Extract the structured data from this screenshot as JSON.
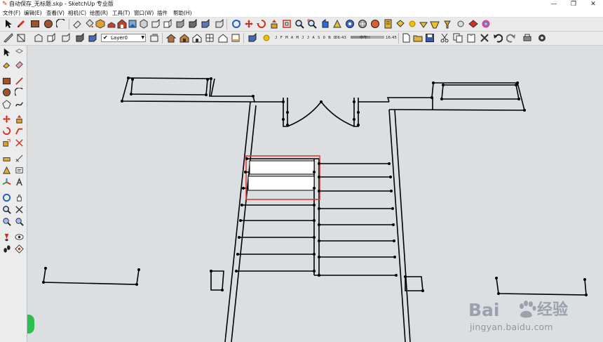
{
  "window": {
    "title": "自动保存_无标题.skp - SketchUp 专业版",
    "minimize_glyph": "—",
    "restore_glyph": "❐",
    "close_glyph": "✕"
  },
  "menu": [
    "文件(F)",
    "编辑(E)",
    "查看(V)",
    "相机(C)",
    "绘图(R)",
    "工具(T)",
    "窗口(W)",
    "插件",
    "帮助(H)"
  ],
  "layer_selector": {
    "check": "✔",
    "value": "Layer0",
    "arrow": "▼"
  },
  "shadow_settings": {
    "months": "J F M A M J J A S O N D",
    "time_start": "06:43",
    "noon": "中午",
    "time_end": "16:45"
  },
  "watermark": {
    "brand": "Bai",
    "brand_cn": "经验",
    "url": "jingyan.baidu.com"
  },
  "colors": {
    "viewport_bg": "#dcdfe2",
    "selection_box": "#e03030",
    "selected_face": "#ffffff",
    "line": "#000000",
    "watermark": "#9aa3ad"
  },
  "icons": {
    "toolbar1": [
      "select-arrow-icon",
      "pencil-icon",
      "rectangle-icon",
      "circle-icon",
      "arc-icon",
      "eraser-icon",
      "paint-bucket-icon",
      "box-iso-icon",
      "box-top-icon",
      "box-front-icon",
      "box-right-icon",
      "box-back-icon",
      "cube-xray-icon",
      "cube-wire-icon",
      "cube-solid-icon",
      "cube-texture-icon",
      "cube-shaded-icon",
      "layer-check-icon",
      "orbit-icon",
      "move-icon",
      "rotate-icon",
      "pushpull-icon",
      "offset-icon",
      "zoom-icon",
      "zoom-extents-icon",
      "walk-icon",
      "look-around-icon",
      "position-camera-icon",
      "section-plane-icon",
      "tape-icon",
      "protractor-icon",
      "text-icon",
      "axes-icon",
      "dimension-icon",
      "model-info-icon",
      "shadows-icon",
      "fog-icon",
      "styles-icon",
      "components-icon",
      "materials-icon",
      "sandbox-icon",
      "geolocate-icon",
      "warehouse-icon",
      "extensions-icon",
      "ruby-icon",
      "color-wheel-icon"
    ],
    "toolbar2": [
      "tape-small-icon",
      "front-view-icon",
      "iso-view-icon",
      "top-view-icon",
      "house-icon",
      "front-house-icon",
      "back-house-icon",
      "home-icon",
      "walls-icon",
      "warehouse-upload-icon",
      "scenes-icon",
      "shadow-toggle-icon",
      "new-file-icon",
      "open-file-icon",
      "save-icon",
      "cut-icon",
      "copy-icon",
      "paste-icon",
      "delete-icon",
      "undo-icon",
      "redo-icon",
      "print-icon",
      "settings-icon"
    ],
    "left_toolbar": [
      "select-icon",
      "make-component-icon",
      "paint-icon",
      "eraser-icon",
      "rectangle-icon",
      "line-icon",
      "circle-icon",
      "arc-icon",
      "polygon-icon",
      "freehand-icon",
      "move-icon",
      "pushpull-icon",
      "rotate-icon",
      "followme-icon",
      "scale-icon",
      "offset-icon",
      "tape-icon",
      "dimension-icon",
      "protractor-icon",
      "text-icon",
      "axes-icon",
      "3dtext-icon",
      "orbit-icon",
      "pan-icon",
      "zoom-icon",
      "zoom-window-icon",
      "zoom-extents-icon",
      "previous-view-icon",
      "position-camera-icon",
      "look-around-icon",
      "walk-icon",
      "section-icon"
    ]
  }
}
